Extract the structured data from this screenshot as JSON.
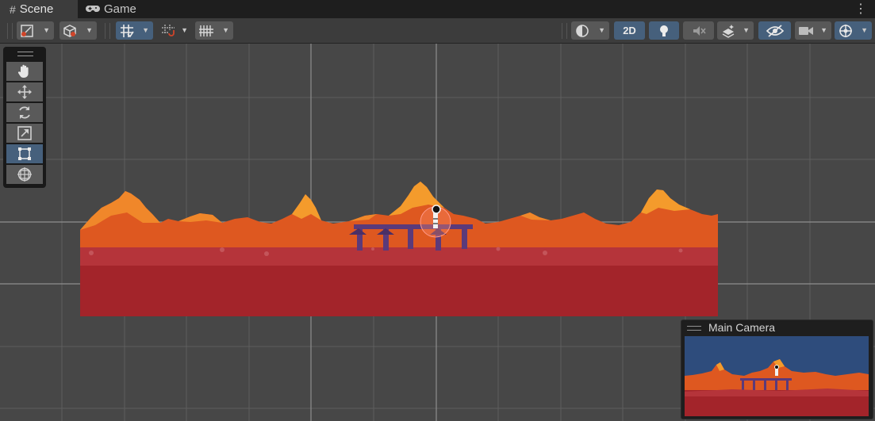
{
  "tabs": [
    {
      "label": "Scene",
      "icon": "hash-icon"
    },
    {
      "label": "Game",
      "icon": "gamepad-icon"
    }
  ],
  "tab_menu_icon": "kebab-menu-icon",
  "toolbar": {
    "left": [
      "draw-mode-icon",
      "render-mode-icon",
      "grid-snap-icon",
      "increment-snap-icon",
      "grid-visibility-icon"
    ],
    "right": [
      "shading-mode-icon",
      "lighting-icon",
      "audio-mute-icon",
      "effects-icon",
      "visibility-icon",
      "camera-icon",
      "gizmos-icon"
    ],
    "mode_2d_label": "2D"
  },
  "tools": [
    "hand-tool-icon",
    "move-tool-icon",
    "rotate-tool-icon",
    "scale-tool-icon",
    "rect-tool-icon",
    "transform-tool-icon"
  ],
  "active_tool": "rect-tool-icon",
  "camera_preview": {
    "title": "Main Camera"
  },
  "colors": {
    "accent": "#46607c",
    "scene_bg": "#474747",
    "sky": "#2e4c7c",
    "rock_orange": "#de5820",
    "rock_highlight": "#f49b2c",
    "ground_red": "#a3242a",
    "bridge_purple": "#5b3a7a"
  }
}
